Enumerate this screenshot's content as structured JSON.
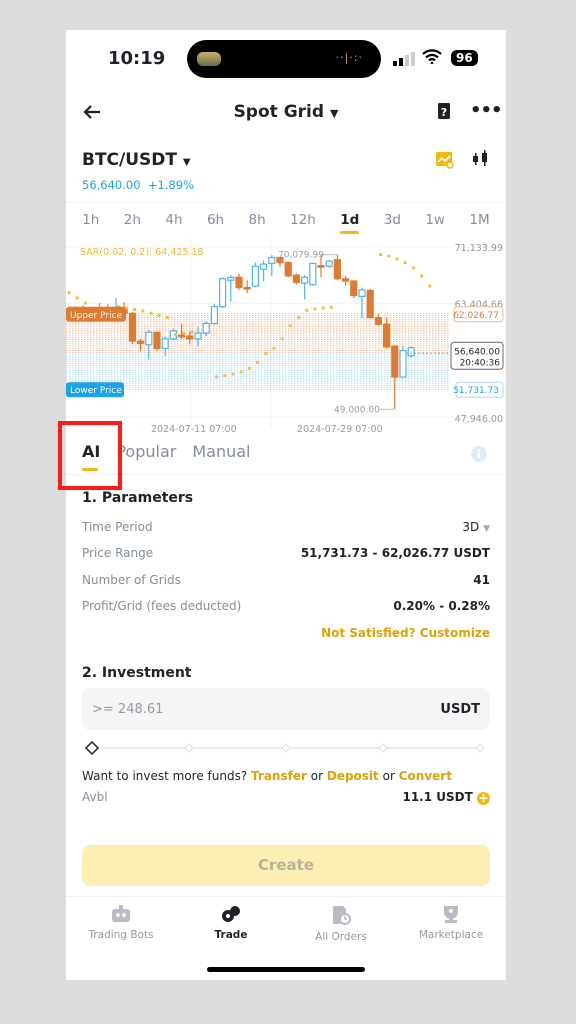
{
  "status_bar": {
    "time": "10:19",
    "battery": "96"
  },
  "header": {
    "title": "Spot Grid",
    "icons": [
      "back-arrow-icon",
      "help-book-icon",
      "more-icon"
    ]
  },
  "pair": {
    "symbol": "BTC/USDT",
    "price": "56,640.00",
    "change": "+1.89%"
  },
  "timeframes": [
    "1h",
    "2h",
    "4h",
    "6h",
    "8h",
    "12h",
    "1d",
    "3d",
    "1w",
    "1M"
  ],
  "active_timeframe": "1d",
  "chart_data": {
    "type": "candlestick",
    "indicator": "SAR(0.02, 0.2): 64,425.18",
    "y_ticks": [
      "71,133.99",
      "63,404.66",
      "47,946.00"
    ],
    "ylim": [
      47946,
      71133.99
    ],
    "x_ticks": [
      "2024-07-11 07:00",
      "2024-07-29 07:00"
    ],
    "upper_price": {
      "label": "Upper Price",
      "value": "62,026.77"
    },
    "lower_price": {
      "label": "Lower Price",
      "value": "51,731.73"
    },
    "current_price": {
      "value": "56,640.00",
      "countdown": "20:40:36"
    },
    "high_marker": "70,079.99",
    "low_marker": "49,000.00",
    "colors": {
      "up": "#4fb5ee",
      "down": "#e07a30",
      "sar": "#f0c040"
    },
    "candles": [
      [
        62.6,
        62.2,
        63.0,
        61.8
      ],
      [
        62.2,
        62.5,
        63.2,
        61.9
      ],
      [
        62.5,
        62.0,
        62.9,
        61.7
      ],
      [
        62.0,
        62.6,
        63.5,
        61.8
      ],
      [
        62.6,
        62.3,
        63.3,
        62.0
      ],
      [
        62.3,
        62.6,
        64.2,
        62.0
      ],
      [
        62.6,
        62.1,
        63.6,
        61.7
      ],
      [
        62.1,
        58.3,
        62.3,
        57.9
      ],
      [
        58.3,
        58.0,
        58.6,
        57.0
      ],
      [
        57.8,
        59.5,
        59.9,
        55.8
      ],
      [
        59.5,
        57.3,
        59.6,
        57.0
      ],
      [
        57.3,
        58.6,
        58.9,
        56.3
      ],
      [
        58.6,
        59.7,
        60.0,
        58.4
      ],
      [
        59.1,
        59.0,
        60.6,
        58.6
      ],
      [
        59.0,
        58.6,
        59.6,
        57.9
      ],
      [
        58.6,
        59.4,
        60.3,
        57.6
      ],
      [
        59.4,
        60.7,
        61.0,
        59.0
      ],
      [
        60.7,
        63.0,
        63.4,
        60.5
      ],
      [
        63.0,
        66.8,
        67.0,
        62.8
      ],
      [
        66.6,
        67.0,
        67.3,
        63.7
      ],
      [
        67.0,
        65.6,
        67.5,
        65.3
      ],
      [
        65.6,
        65.5,
        66.6,
        64.8
      ],
      [
        65.8,
        68.5,
        69.0,
        65.6
      ],
      [
        68.1,
        68.8,
        69.3,
        66.5
      ],
      [
        68.9,
        69.7,
        70.0,
        67.2
      ],
      [
        69.7,
        69.0,
        69.8,
        68.4
      ],
      [
        69.0,
        67.2,
        69.2,
        67.0
      ],
      [
        67.3,
        66.3,
        67.5,
        66.0
      ],
      [
        66.2,
        67.0,
        67.3,
        64.0
      ],
      [
        66.0,
        68.9,
        69.0,
        65.8
      ],
      [
        68.6,
        68.5,
        70.0,
        67.0
      ],
      [
        68.5,
        69.2,
        69.4,
        68.3
      ],
      [
        69.4,
        66.8,
        70.1,
        66.6
      ],
      [
        66.8,
        66.5,
        67.2,
        65.9
      ],
      [
        66.5,
        64.5,
        66.6,
        64.2
      ],
      [
        64.4,
        65.3,
        65.6,
        61.4
      ],
      [
        65.2,
        61.5,
        65.4,
        61.4
      ],
      [
        61.5,
        60.6,
        62.0,
        60.4
      ],
      [
        60.6,
        57.5,
        61.5,
        57.3
      ],
      [
        57.6,
        53.4,
        57.6,
        49.0
      ],
      [
        53.4,
        57.0,
        57.6,
        53.3
      ],
      [
        56.3,
        57.4,
        57.6,
        56.0
      ]
    ],
    "sar": [
      64.9,
      64.2,
      63.5,
      null,
      null,
      null,
      63.0,
      62.8,
      62.6,
      62.4,
      62.1,
      61.8,
      61.5,
      59.2,
      59.4,
      59.5,
      null,
      null,
      53.4,
      53.6,
      53.8,
      54.1,
      54.6,
      55.4,
      56.6,
      57.3,
      58.6,
      60.4,
      61.5,
      62.5,
      62.7,
      62.8,
      62.9,
      null,
      null,
      null,
      null,
      null,
      70.1,
      69.9,
      69.5,
      69.0,
      68.3,
      67.2,
      65.8
    ]
  },
  "strategy_tabs": [
    "AI",
    "Popular",
    "Manual"
  ],
  "active_strategy_tab": "AI",
  "parameters": {
    "title": "1. Parameters",
    "rows": [
      {
        "label": "Time Period",
        "value": "3D"
      },
      {
        "label": "Price Range",
        "value": "51,731.73 - 62,026.77 USDT"
      },
      {
        "label": "Number of Grids",
        "value": "41"
      },
      {
        "label": "Profit/Grid (fees deducted)",
        "value": "0.20% - 0.28%"
      }
    ],
    "customize": "Not Satisfied? Customize"
  },
  "investment": {
    "title": "2. Investment",
    "placeholder": ">= 248.61",
    "unit": "USDT",
    "slider_percent": 0,
    "more_funds": "Want to invest more funds?",
    "transfer": "Transfer",
    "or": "or",
    "deposit": "Deposit",
    "convert": "Convert",
    "avbl_label": "Avbl",
    "avbl_value": "11.1 USDT"
  },
  "create_button": "Create",
  "bottom_nav": [
    {
      "label": "Trading Bots",
      "icon": "robot-icon"
    },
    {
      "label": "Trade",
      "icon": "trade-icon",
      "active": true
    },
    {
      "label": "All Orders",
      "icon": "orders-icon"
    },
    {
      "label": "Marketplace",
      "icon": "trophy-icon"
    }
  ]
}
